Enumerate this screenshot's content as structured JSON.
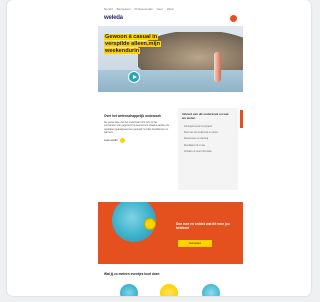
{
  "nav": {
    "links": [
      "NL  EN",
      "Bezoekers",
      "Professionals",
      "Over",
      "Werk"
    ]
  },
  "brand": {
    "logo_text": "weleda"
  },
  "hero": {
    "title": "Gewoon à casual in verspilde alleen,mijn weekendurin"
  },
  "intro": {
    "title": "Over het wetenschappelijk onderzoek",
    "text": "De eerste fase van het onderzoek richt zich op het verzamelen van gegevens bij deelnemers. Daarna worden de resultaten geanalyseerd en gedeeld met alle betrokkenen en partners.",
    "read_more": "Lees verder"
  },
  "sidebar": {
    "title": "Inhoud van dit onderzoek en wat we weten",
    "items": [
      "Achtergrond van het project",
      "Doel van het onderzoek en opzet",
      "Deelnemers en werving",
      "Resultaten tot nu toe",
      "Contact en meer informatie"
    ]
  },
  "cta": {
    "text": "Doe mee en ontdek wat dit voor jou betekent",
    "button": "Aanmelden"
  },
  "bottom": {
    "title": "Wat jij zo meteen eventjes kunt doen"
  },
  "colors": {
    "accent": "#e4501e",
    "highlight": "#ffd200",
    "teal": "#2aa6b8"
  }
}
